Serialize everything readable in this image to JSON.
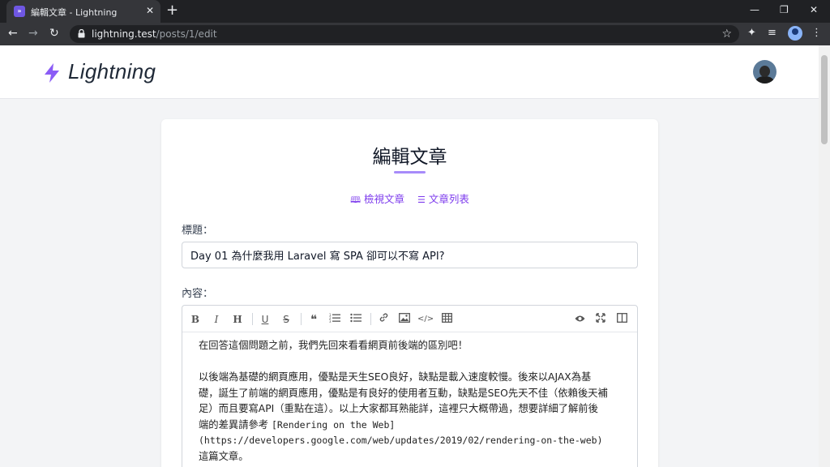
{
  "browser": {
    "tab_title": "編輯文章 - Lightning",
    "favicon_text": "»",
    "url_host": "lightning.test",
    "url_path": "/posts/1/edit"
  },
  "header": {
    "logo_text": "Lightning"
  },
  "card": {
    "title": "編輯文章",
    "links": [
      {
        "icon": "book-open-icon",
        "label": "檢視文章"
      },
      {
        "icon": "list-icon",
        "label": "文章列表"
      }
    ],
    "title_label": "標題：",
    "title_value": "Day 01 為什麼我用 Laravel 寫 SPA 卻可以不寫 API?",
    "content_label": "內容："
  },
  "editor": {
    "toolbar_left": [
      "B",
      "I",
      "H",
      "U",
      "S",
      "❝",
      "ol",
      "ul",
      "link",
      "image",
      "</>",
      "table"
    ],
    "toolbar_right": [
      "preview",
      "fullscreen",
      "side-by-side"
    ],
    "content": {
      "p1": "在回答這個問題之前，我們先回來看看網頁前後端的區別吧！",
      "p2_l1": "以後端為基礎的網頁應用，優點是天生SEO良好，缺點是載入速度較慢。後來以AJAX為基",
      "p2_l2": "礎，誕生了前端的網頁應用，優點是有良好的使用者互動，缺點是SEO先天不佳（依賴後天補",
      "p2_l3": "足）而且要寫API（重點在這）。以上大家都耳熟能詳，這裡只大概帶過，想要詳細了解前後",
      "p2_l4_text": "端的差異請參考 ",
      "p2_l4_link": "[Rendering on the Web]",
      "p2_l5": "(https://developers.google.com/web/updates/2019/02/rendering-on-the-web)",
      "p2_l6": "這篇文章。"
    }
  },
  "colors": {
    "accent": "#7c3aed",
    "accent_light": "#a78bfa",
    "page_bg": "#f3f4f6"
  }
}
